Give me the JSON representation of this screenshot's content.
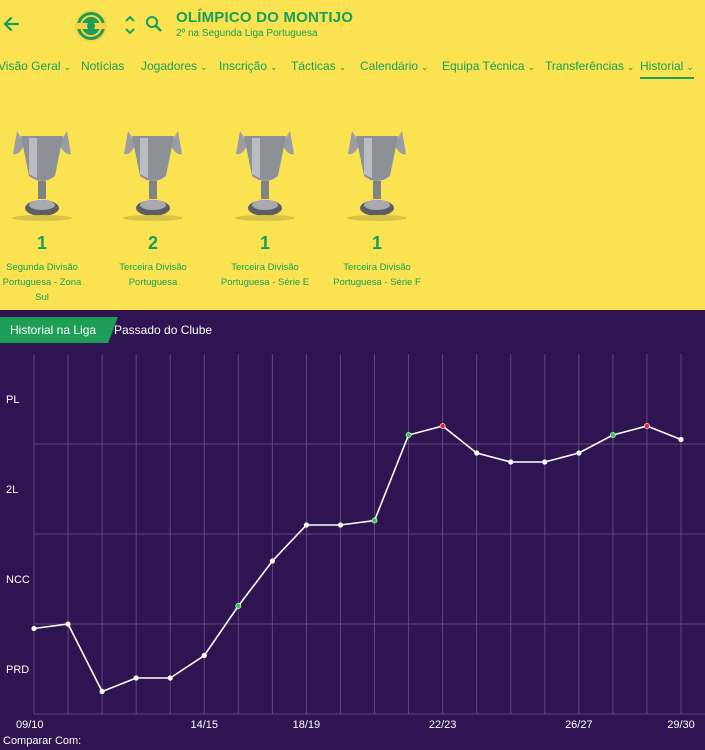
{
  "header": {
    "club_name": "OLÍMPICO DO MONTIJO",
    "subtitle": "2º na Segunda Liga Portuguesa"
  },
  "nav": {
    "tabs": [
      {
        "label": "Visão Geral",
        "dropdown": true
      },
      {
        "label": "Notícias",
        "dropdown": false
      },
      {
        "label": "Jogadores",
        "dropdown": true
      },
      {
        "label": "Inscrição",
        "dropdown": true
      },
      {
        "label": "Tácticas",
        "dropdown": true
      },
      {
        "label": "Calendário",
        "dropdown": true
      },
      {
        "label": "Equipa Técnica",
        "dropdown": true
      },
      {
        "label": "Transferências",
        "dropdown": true
      },
      {
        "label": "Historial",
        "dropdown": true,
        "active": true
      }
    ]
  },
  "trophies": [
    {
      "count": "1",
      "name": "Segunda Divisão Portuguesa - Zona Sul"
    },
    {
      "count": "2",
      "name": "Terceira Divisão Portuguesa"
    },
    {
      "count": "1",
      "name": "Terceira Divisão Portuguesa - Série E"
    },
    {
      "count": "1",
      "name": "Terceira Divisão Portuguesa - Série F"
    }
  ],
  "subtabs": {
    "active": "Historial na Liga",
    "other": "Passado do Clube"
  },
  "chart_data": {
    "type": "line",
    "y_levels": [
      "PRD",
      "NCC",
      "2L",
      "PL"
    ],
    "x_tick_labels": [
      "09/10",
      "14/15",
      "18/19",
      "22/23",
      "26/27",
      "29/30"
    ],
    "x_tick_seasons": [
      0,
      5,
      8,
      12,
      16,
      19
    ],
    "seasons_count": 20,
    "points": [
      {
        "season": 0,
        "level": 0.95,
        "mark": "none"
      },
      {
        "season": 1,
        "level": 1.0,
        "mark": "none"
      },
      {
        "season": 2,
        "level": 0.25,
        "mark": "none"
      },
      {
        "season": 3,
        "level": 0.4,
        "mark": "none"
      },
      {
        "season": 4,
        "level": 0.4,
        "mark": "none"
      },
      {
        "season": 5,
        "level": 0.65,
        "mark": "none"
      },
      {
        "season": 6,
        "level": 1.2,
        "mark": "promotion"
      },
      {
        "season": 7,
        "level": 1.7,
        "mark": "none"
      },
      {
        "season": 8,
        "level": 2.1,
        "mark": "none"
      },
      {
        "season": 9,
        "level": 2.1,
        "mark": "none"
      },
      {
        "season": 10,
        "level": 2.15,
        "mark": "promotion"
      },
      {
        "season": 11,
        "level": 3.1,
        "mark": "promotion"
      },
      {
        "season": 12,
        "level": 3.2,
        "mark": "title"
      },
      {
        "season": 13,
        "level": 2.9,
        "mark": "none"
      },
      {
        "season": 14,
        "level": 2.8,
        "mark": "none"
      },
      {
        "season": 15,
        "level": 2.8,
        "mark": "none"
      },
      {
        "season": 16,
        "level": 2.9,
        "mark": "none"
      },
      {
        "season": 17,
        "level": 3.1,
        "mark": "promotion"
      },
      {
        "season": 18,
        "level": 3.2,
        "mark": "title"
      },
      {
        "season": 19,
        "level": 3.05,
        "mark": "none"
      }
    ],
    "colors": {
      "background": "#2e1450",
      "line": "#ffffff",
      "promotion": "#2ecc40",
      "title": "#e8242a",
      "grid": "#5a4a7a"
    }
  },
  "footer": {
    "compare_label": "Comparar Com:"
  }
}
